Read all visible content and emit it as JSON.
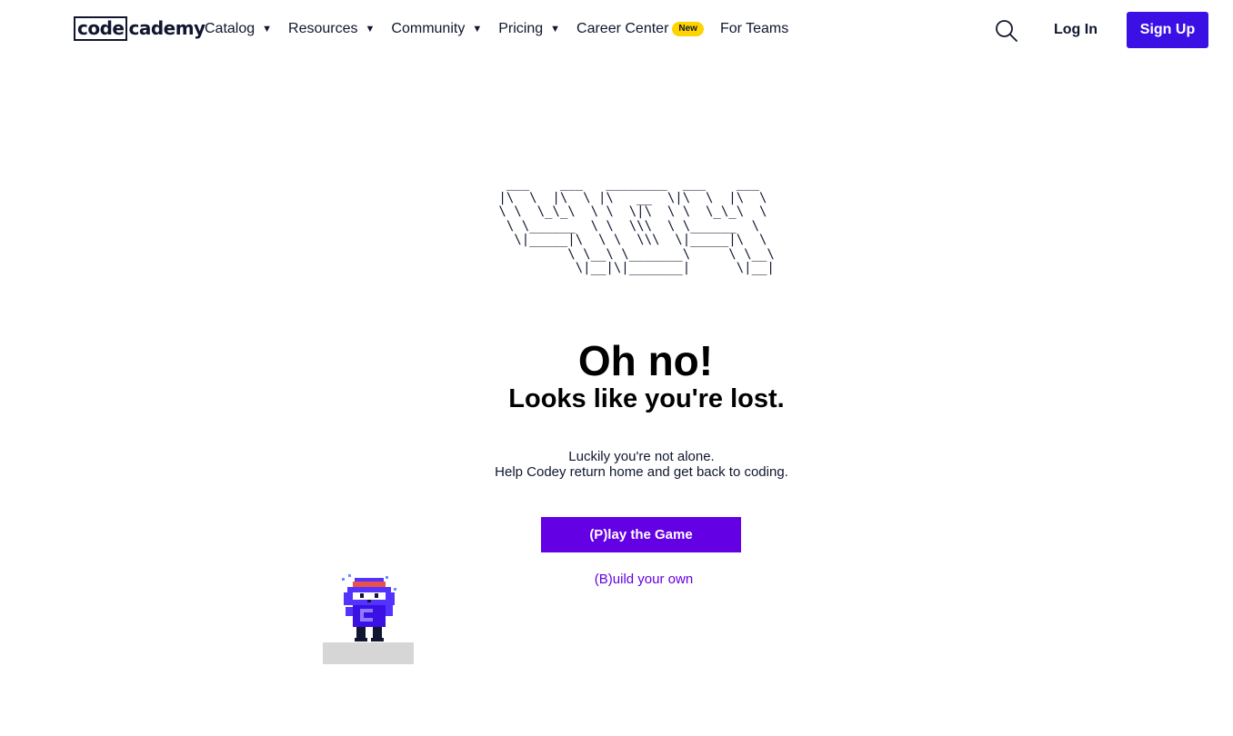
{
  "header": {
    "logo_part1": "code",
    "logo_part2": "cademy",
    "nav": {
      "catalog": "Catalog",
      "resources": "Resources",
      "community": "Community",
      "pricing": "Pricing",
      "career_center": "Career Center",
      "career_badge": "New",
      "for_teams": "For Teams"
    },
    "login_label": "Log In",
    "signup_label": "Sign Up",
    "search_icon": "search-icon"
  },
  "main": {
    "ascii_art": "  ___    ___   ________  ___    ___\n |\\  \\  |\\  \\ |\\   __  \\|\\  \\  |\\  \\\n \\ \\  \\_\\_\\  \\ \\  \\|\\  \\ \\  \\_\\_\\  \\\n  \\ \\______  \\ \\  \\\\\\  \\ \\______  \\\n   \\|_____|\\  \\ \\  \\\\\\  \\|_____|\\  \\\n          \\ \\__\\ \\_______\\     \\ \\__\\\n           \\|__|\\|_______|      \\|__|",
    "headline": "Oh no!",
    "subheadline": "Looks like you're lost.",
    "message_line1": "Luckily you're not alone.",
    "message_line2": "Help Codey return home and get back to coding.",
    "play_button": "(P)lay the Game",
    "build_link": "(B)uild your own"
  },
  "colors": {
    "brand_navy": "#10162f",
    "signup_blue": "#3a10e5",
    "play_purple": "#6400e4",
    "badge_yellow": "#ffd300",
    "platform_gray": "#d6d6d6"
  }
}
